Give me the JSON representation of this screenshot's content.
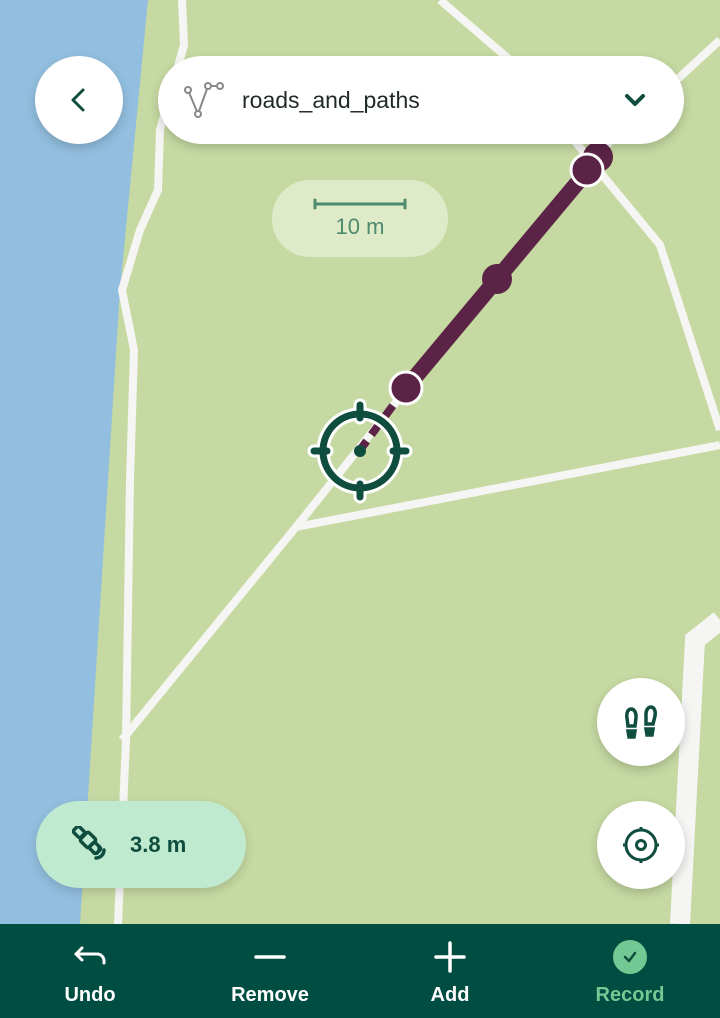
{
  "header": {
    "back_icon": "chevron-left-icon",
    "layer_icon": "line-layer-icon",
    "layer_name": "roads_and_paths",
    "dropdown_icon": "chevron-down-icon"
  },
  "scale_bar": {
    "label": "10 m"
  },
  "gps": {
    "icon": "satellite-icon",
    "accuracy": "3.8 m"
  },
  "map_buttons": [
    {
      "name": "stream-mode",
      "icon": "footsteps-icon"
    },
    {
      "name": "center-on-location",
      "icon": "gps-locate-icon"
    }
  ],
  "colors": {
    "primary": "#004d41",
    "accent": "#73c993",
    "feature": "#5b2446",
    "land": "#c6d9a2",
    "water": "#92bfdf",
    "road": "#f5f5f3"
  },
  "toolbar": {
    "items": [
      {
        "label": "Undo",
        "icon": "undo-icon"
      },
      {
        "label": "Remove",
        "icon": "minus-icon"
      },
      {
        "label": "Add",
        "icon": "plus-icon"
      },
      {
        "label": "Record",
        "icon": "check-circle-icon",
        "active": true
      }
    ]
  }
}
